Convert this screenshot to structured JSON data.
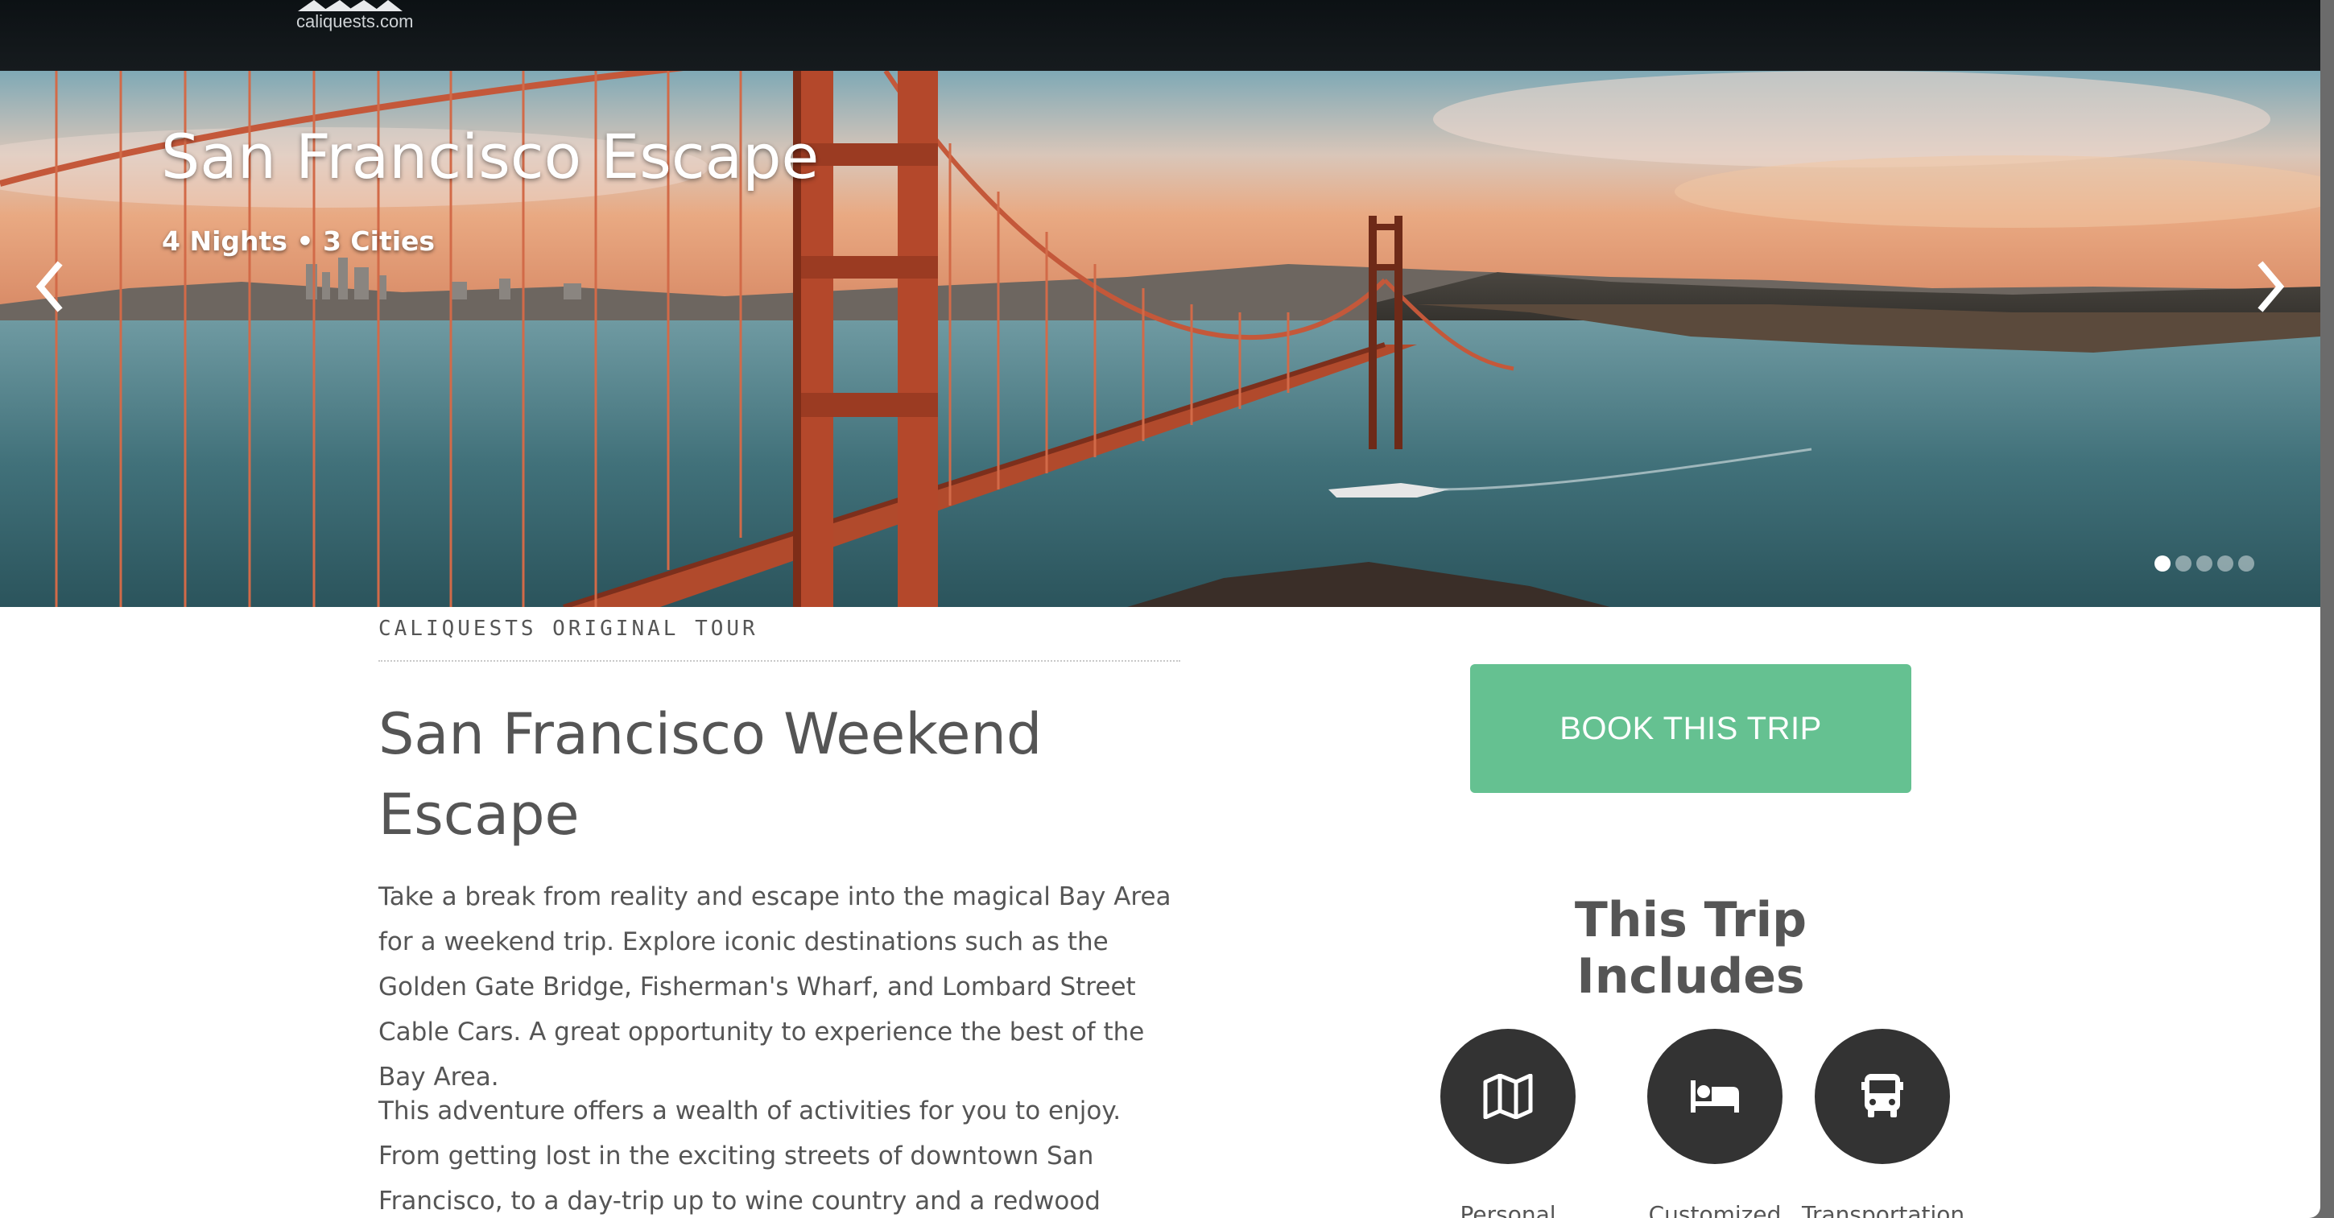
{
  "site": {
    "logo_text": "caliquests.com"
  },
  "hero": {
    "title": "San Francisco Escape",
    "subtitle": "4 Nights • 3 Cities",
    "prev_icon": "chevron-left-icon",
    "next_icon": "chevron-right-icon",
    "slide_count": 5,
    "active_slide": 1
  },
  "tour": {
    "tag": "CALIQUESTS ORIGINAL TOUR",
    "title": "San Francisco Weekend Escape",
    "description_1": "Take a break from reality and escape into the magical Bay Area for a weekend trip. Explore iconic destinations such as the Golden Gate Bridge, Fisherman's Wharf, and Lombard Street Cable Cars. A great opportunity to experience the best of the Bay Area.",
    "description_2": "This adventure offers a wealth of activities for you to enjoy. From getting lost in the exciting streets of downtown San Francisco, to a day-trip up to wine country and a redwood forest,"
  },
  "booking": {
    "button_label": "BOOK THIS TRIP",
    "button_color": "#65c191"
  },
  "includes": {
    "title": "This Trip Includes",
    "items": [
      {
        "icon": "map-icon",
        "label": "Personal"
      },
      {
        "icon": "bed-icon",
        "label": "Customized"
      },
      {
        "icon": "bus-icon",
        "label": "Transportation"
      }
    ]
  }
}
